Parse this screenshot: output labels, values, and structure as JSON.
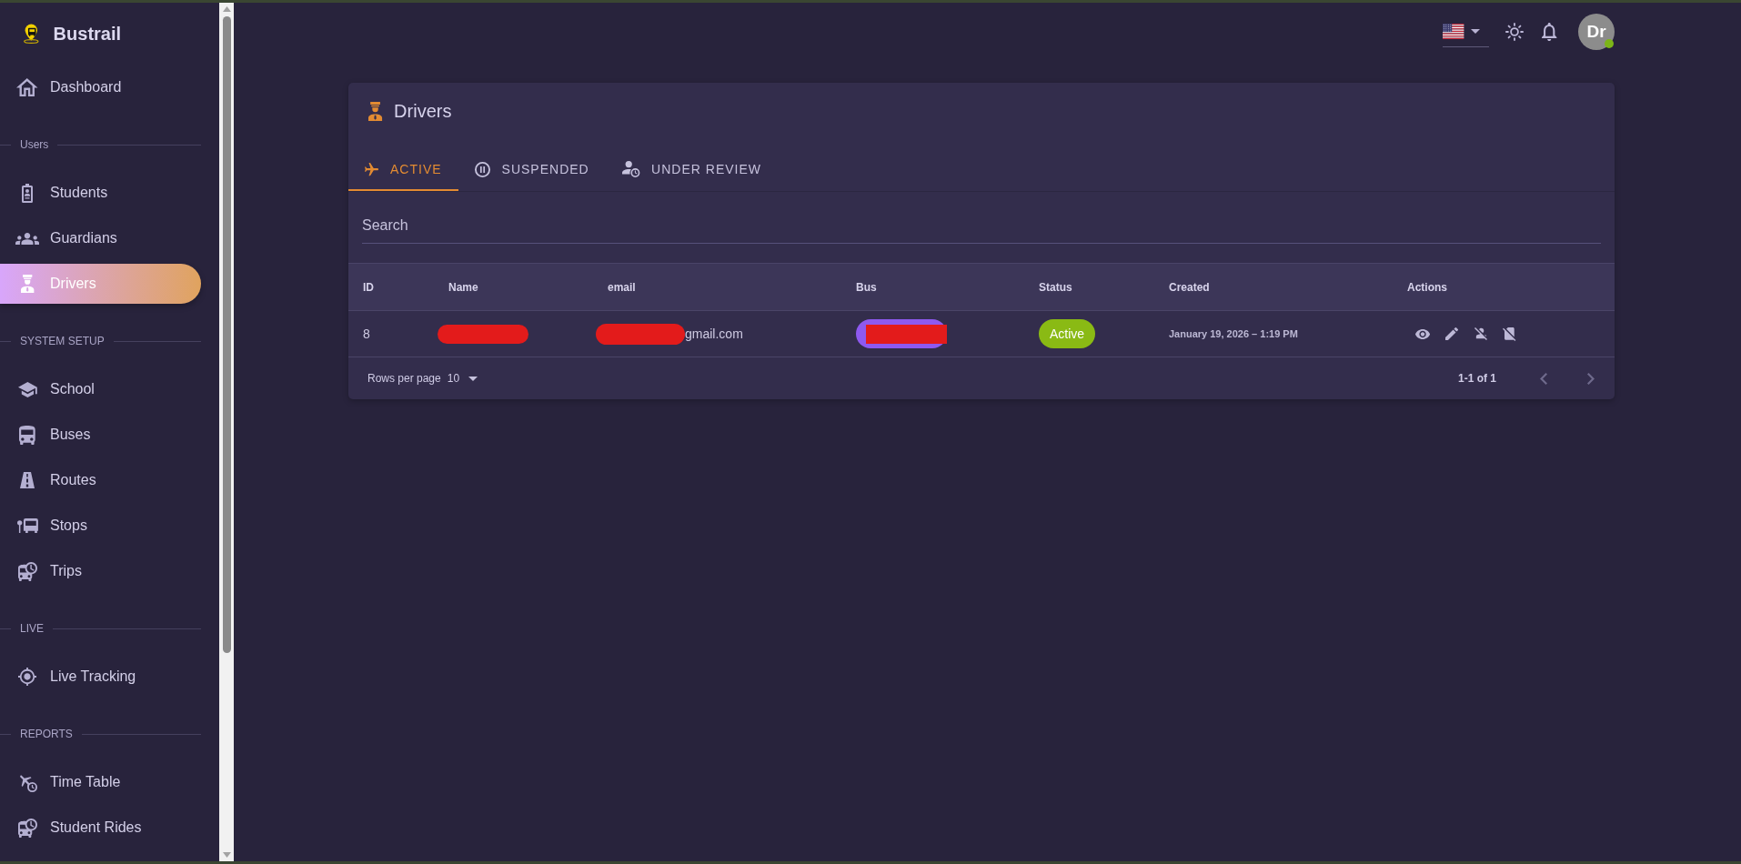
{
  "sidebar": {
    "brand": "Bustrail",
    "groups": [
      {
        "items": [
          {
            "label": "Dashboard",
            "selected": false
          }
        ]
      },
      {
        "title": "Users",
        "items": [
          {
            "label": "Students",
            "selected": false
          },
          {
            "label": "Guardians",
            "selected": false
          },
          {
            "label": "Drivers",
            "selected": true
          }
        ]
      },
      {
        "title": "SYSTEM SETUP",
        "items": [
          {
            "label": "School",
            "selected": false
          },
          {
            "label": "Buses",
            "selected": false
          },
          {
            "label": "Routes",
            "selected": false
          },
          {
            "label": "Stops",
            "selected": false
          },
          {
            "label": "Trips",
            "selected": false
          }
        ]
      },
      {
        "title": "LIVE",
        "items": [
          {
            "label": "Live Tracking",
            "selected": false
          }
        ]
      },
      {
        "title": "REPORTS",
        "items": [
          {
            "label": "Time Table",
            "selected": false
          },
          {
            "label": "Student Rides",
            "selected": false
          }
        ]
      }
    ]
  },
  "topbar": {
    "avatar": {
      "initials": "Dr",
      "online": true
    }
  },
  "page": {
    "title": "Drivers",
    "tabs": [
      {
        "label": "ACTIVE",
        "selected": true
      },
      {
        "label": "SUSPENDED",
        "selected": false
      },
      {
        "label": "UNDER REVIEW",
        "selected": false
      }
    ],
    "search": {
      "placeholder": "Search"
    },
    "table": {
      "columns": [
        "ID",
        "Name",
        "email",
        "Bus",
        "Status",
        "Created",
        "Actions"
      ],
      "rows": [
        {
          "id": "8",
          "name_redacted": true,
          "email": "gmail.com",
          "email_redacted": true,
          "bus_redacted": true,
          "status": "Active",
          "created": "January 19, 2026 – 1:19 PM"
        }
      ]
    },
    "pagination": {
      "rows_per_page_label": "Rows per page",
      "rows_per_page": "10",
      "range": "1-1 of 1",
      "prev": {
        "disabled": true
      },
      "next": {
        "disabled": true
      }
    }
  }
}
